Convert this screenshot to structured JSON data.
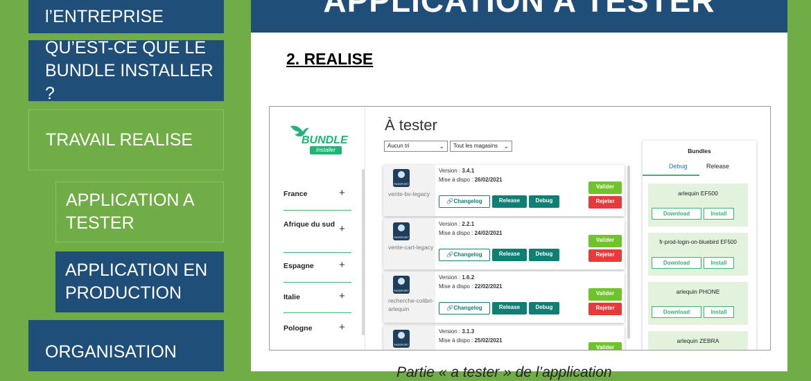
{
  "nav": {
    "entreprise": "l’ENTREPRISE",
    "bundle_q": "QU’EST-CE QUE LE BUNDLE INSTALLER ?",
    "travail": "TRAVAIL REALISE",
    "app_tester": "APPLICATION A TESTER",
    "app_prod": "APPLICATION EN PRODUCTION",
    "organisation": "ORGANISATION"
  },
  "slide": {
    "banner_title": "APPLICATION A TESTER",
    "section_title": "2. REALISE",
    "caption": "Partie « a tester » de l’application"
  },
  "app": {
    "logo_text": "BUNDLE",
    "logo_sub": "Installer",
    "title": "À tester",
    "sort_select": "Aucun tri",
    "store_select": "Tout les magasins",
    "countries": [
      {
        "name": "France",
        "plus": "+"
      },
      {
        "name": "Afrique du sud",
        "plus": "+"
      },
      {
        "name": "Espagne",
        "plus": "+"
      },
      {
        "name": "Italie",
        "plus": "+"
      },
      {
        "name": "Pologne",
        "plus": "+"
      }
    ],
    "cards": [
      {
        "name": "vente-bv-legacy",
        "version_label": "Version :",
        "version": "3.4.1",
        "dispo_label": "Mise à dispo :",
        "dispo": "26/02/2021"
      },
      {
        "name": "vente-cart-legacy",
        "version_label": "Version :",
        "version": "2.2.1",
        "dispo_label": "Mise à dispo :",
        "dispo": "24/02/2021"
      },
      {
        "name": "recherche-colibri-arlequin",
        "version_label": "Version :",
        "version": "1.6.2",
        "dispo_label": "Mise à dispo :",
        "dispo": "22/02/2021"
      },
      {
        "name": "",
        "version_label": "Version :",
        "version": "3.1.3",
        "dispo_label": "Mise à dispo :",
        "dispo": "25/02/2021"
      }
    ],
    "buttons": {
      "changelog": "Changelog",
      "release": "Release",
      "debug": "Debug",
      "valider": "Valider",
      "rejeter": "Rejeter"
    },
    "bundles": {
      "title": "Bundles",
      "tab_debug": "Debug",
      "tab_release": "Release",
      "download": "Download",
      "install": "Install",
      "items": [
        "arlequin EF500",
        "fr-prod-login-on-bluebird EF500",
        "arlequin PHONE",
        "arlequin ZEBRA"
      ]
    }
  }
}
